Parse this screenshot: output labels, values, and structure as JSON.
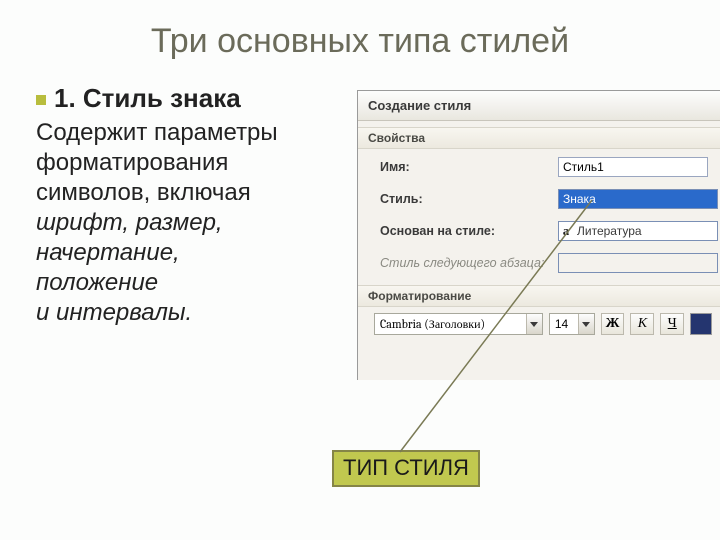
{
  "slide": {
    "title": "Три основных типа стилей",
    "subheading": "1. Стиль знака",
    "body_line1": "Содержит параметры",
    "body_line2": "форматирования",
    "body_line3": "символов, включая",
    "body_italic1": "шрифт, размер,",
    "body_italic2": "начертание,",
    "body_italic3": "положение",
    "body_italic4": "и интервалы.",
    "callout": "ТИП СТИЛЯ"
  },
  "dialog": {
    "title": "Создание стиля",
    "section_properties": "Свойства",
    "labels": {
      "name": "Имя:",
      "style": "Стиль:",
      "based_on": "Основан на стиле:",
      "next": "Стиль следующего абзаца:"
    },
    "values": {
      "name": "Стиль1",
      "style": "Знака",
      "based_on_icon": "a",
      "based_on": "Литература",
      "next": ""
    },
    "section_format": "Форматирование",
    "format": {
      "font": "Cambria (Заголовки)",
      "size": "14",
      "bold": "Ж",
      "italic": "К",
      "underline": "Ч"
    }
  }
}
